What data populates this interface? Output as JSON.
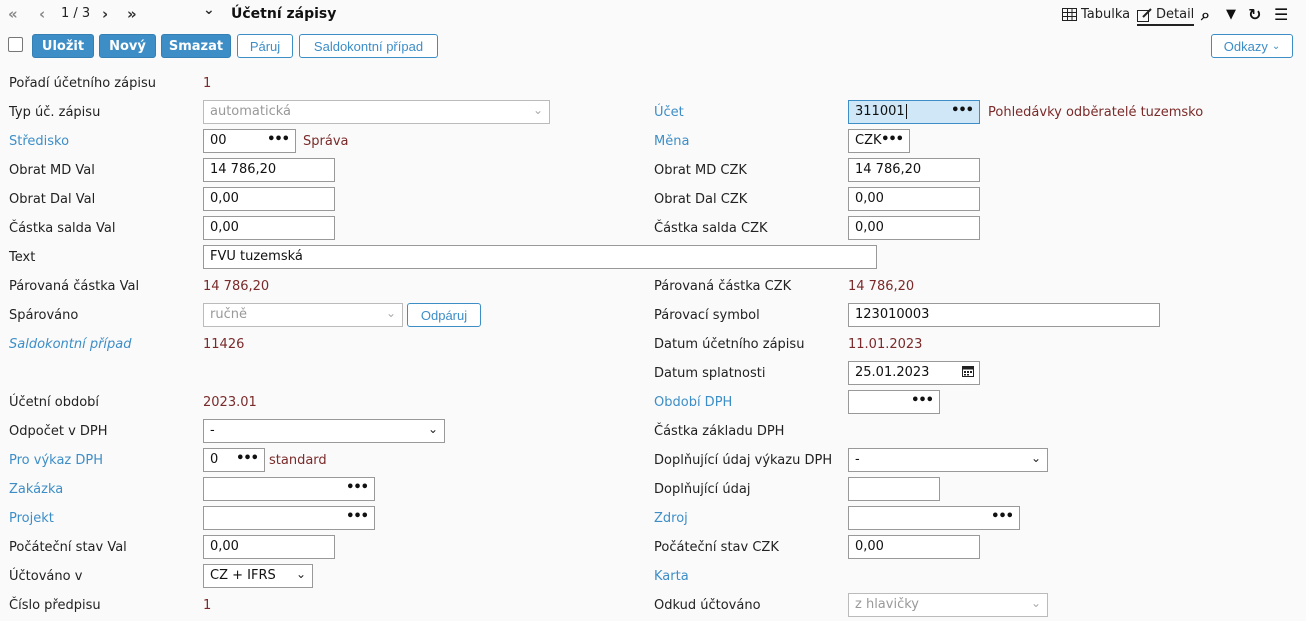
{
  "toolbar": {
    "first_icon": "«",
    "prev_icon": "‹",
    "pager": "1 / 3",
    "next_icon": "›",
    "last_icon": "»",
    "dropdown_icon": "⌄",
    "title": "Účetní zápisy",
    "view_table_label": "Tabulka",
    "view_detail_label": "Detail",
    "search_icon": "⌕",
    "filter_icon": "▼",
    "refresh_icon": "↻",
    "menu_icon": "☰"
  },
  "actions": {
    "save": "Uložit",
    "new": "Nový",
    "delete": "Smazat",
    "pair": "Páruj",
    "balance_case": "Saldokontní případ",
    "links": "Odkazy"
  },
  "form": {
    "poradi_label": "Pořadí účetního zápisu",
    "poradi_value": "1",
    "typ_label": "Typ úč. zápisu",
    "typ_value": "automatická",
    "ucet_label": "Účet",
    "ucet_value": "311001",
    "ucet_desc": "Pohledávky odběratelé tuzemsko",
    "stredisko_label": "Středisko",
    "stredisko_value": "00",
    "stredisko_desc": "Správa",
    "mena_label": "Měna",
    "mena_value": "CZK",
    "obrat_md_val_label": "Obrat MD Val",
    "obrat_md_val": "14 786,20",
    "obrat_md_czk_label": "Obrat MD CZK",
    "obrat_md_czk": "14 786,20",
    "obrat_dal_val_label": "Obrat Dal Val",
    "obrat_dal_val": "0,00",
    "obrat_dal_czk_label": "Obrat Dal CZK",
    "obrat_dal_czk": "0,00",
    "castka_salda_val_label": "Částka salda Val",
    "castka_salda_val": "0,00",
    "castka_salda_czk_label": "Částka salda CZK",
    "castka_salda_czk": "0,00",
    "text_label": "Text",
    "text_value": "FVU tuzemská",
    "parovana_val_label": "Párovaná částka Val",
    "parovana_val": "14 786,20",
    "parovana_czk_label": "Párovaná částka CZK",
    "parovana_czk": "14 786,20",
    "sparovano_label": "Spárováno",
    "sparovano_value": "ručně",
    "odparuj_button": "Odpáruj",
    "parovaci_symbol_label": "Párovací symbol",
    "parovaci_symbol": "123010003",
    "saldokontni_label": "Saldokontní případ",
    "saldokontni_value": "11426",
    "datum_zapisu_label": "Datum účetního zápisu",
    "datum_zapisu": "11.01.2023",
    "datum_splatnosti_label": "Datum splatnosti",
    "datum_splatnosti": "25.01.2023",
    "ucetni_obdobi_label": "Účetní období",
    "ucetni_obdobi": "2023.01",
    "obdobi_dph_label": "Období DPH",
    "obdobi_dph": "",
    "odpocet_dph_label": "Odpočet v DPH",
    "odpocet_dph": "-",
    "castka_zakladu_label": "Částka základu DPH",
    "pro_vykaz_label": "Pro výkaz DPH",
    "pro_vykaz_value": "0",
    "pro_vykaz_desc": "standard",
    "doplnujici_vykaz_label": "Doplňující údaj výkazu DPH",
    "doplnujici_vykaz": "-",
    "zakazka_label": "Zakázka",
    "zakazka": "",
    "doplnujici_udaj_label": "Doplňující údaj",
    "doplnujici_udaj": "",
    "projekt_label": "Projekt",
    "projekt": "",
    "zdroj_label": "Zdroj",
    "zdroj": "",
    "pocatecni_val_label": "Počáteční stav Val",
    "pocatecni_val": "0,00",
    "pocatecni_czk_label": "Počáteční stav CZK",
    "pocatecni_czk": "0,00",
    "uctovano_label": "Účtováno v",
    "uctovano_value": "CZ + IFRS",
    "karta_label": "Karta",
    "cislo_predpisu_label": "Číslo předpisu",
    "cislo_predpisu": "1",
    "odkud_label": "Odkud účtováno",
    "odkud_value": "z hlavičky"
  }
}
